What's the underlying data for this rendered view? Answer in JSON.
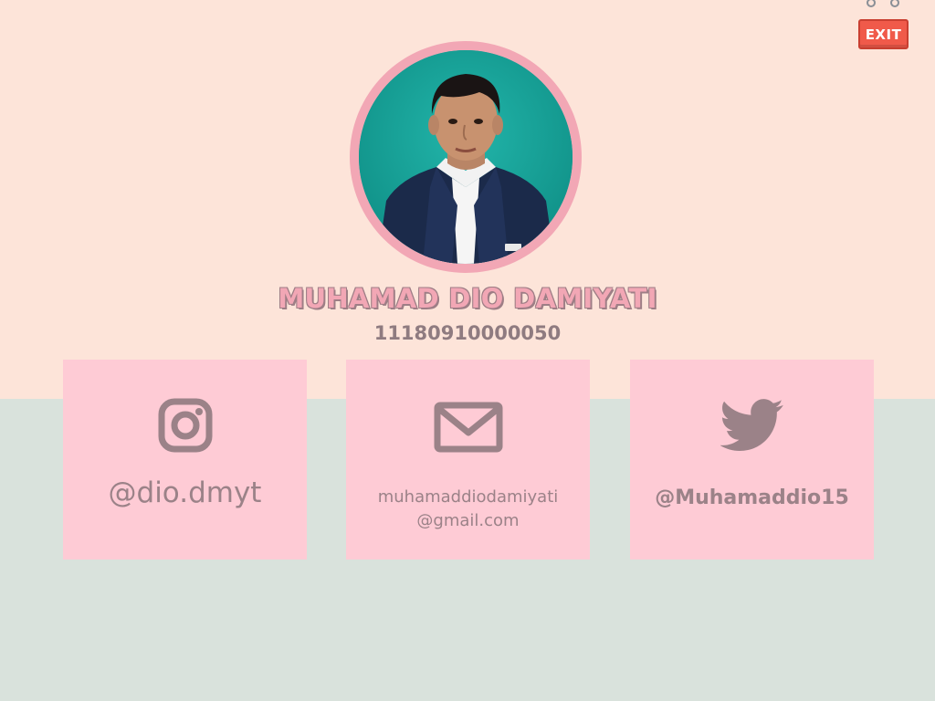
{
  "header": {
    "exit_label": "EXIT"
  },
  "profile": {
    "name": "MUHAMAD DIO DAMIYATI",
    "id_number": "11180910000050"
  },
  "contacts": [
    {
      "icon": "instagram-icon",
      "label": "@dio.dmyt"
    },
    {
      "icon": "mail-icon",
      "label_line1": "muhamaddiodamiyati",
      "label_line2": "@gmail.com"
    },
    {
      "icon": "twitter-icon",
      "label": "@Muhamaddio15"
    }
  ],
  "colors": {
    "top_background": "#fde4d9",
    "bottom_background": "#d9e2dc",
    "card": "#fecbd5",
    "accent_pink": "#f2a7b5",
    "text_muted": "#9b8288",
    "exit_button": "#f05a4a"
  }
}
